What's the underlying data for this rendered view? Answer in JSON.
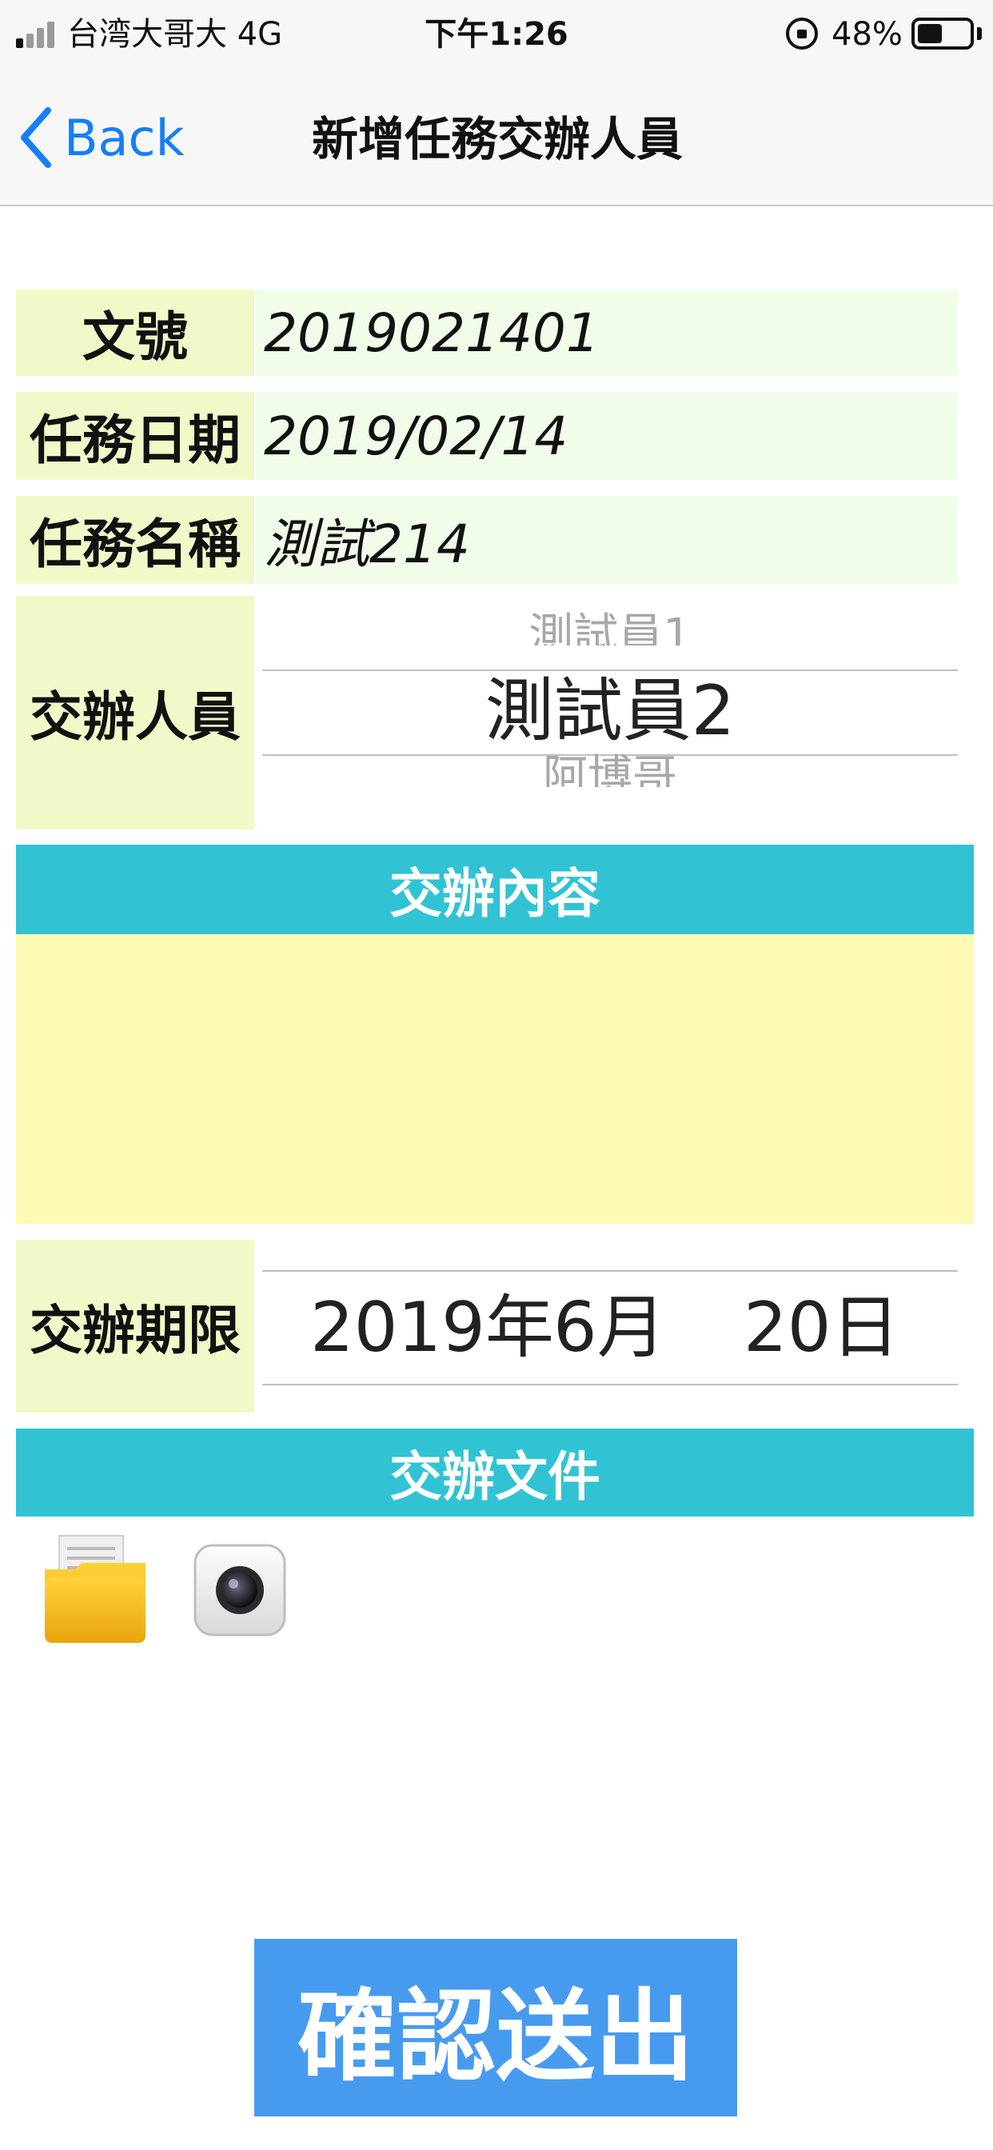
{
  "status_bar": {
    "carrier": "台湾大哥大   4G",
    "time": "下午1:26",
    "battery_percent": "48%",
    "battery_level": 0.48,
    "signal_bars": 1
  },
  "nav": {
    "back_label": "Back",
    "title": "新增任務交辦人員",
    "accent_color": "#147efb"
  },
  "form": {
    "doc_number": {
      "label": "文號",
      "value": "2019021401"
    },
    "task_date": {
      "label": "任務日期",
      "value": "2019/02/14"
    },
    "task_name": {
      "label": "任務名稱",
      "value": "測試214"
    },
    "assignee": {
      "label": "交辦人員",
      "options_visible": [
        "測試員1",
        "測試員2",
        "阿博哥"
      ],
      "selected": "測試員2"
    },
    "content": {
      "header": "交辦內容",
      "value": ""
    },
    "deadline": {
      "label": "交辦期限",
      "year": "2019年",
      "month": "6月",
      "day": "20日"
    },
    "files": {
      "header": "交辦文件",
      "icons": [
        "folder-icon",
        "camera-icon"
      ]
    }
  },
  "submit_label": "確認送出",
  "colors": {
    "label_bg": "#f2f9c8",
    "value_bg": "#f1fce9",
    "section_header": "#31c3d4",
    "content_bg": "#fefab3",
    "submit_bg": "#479bef"
  }
}
